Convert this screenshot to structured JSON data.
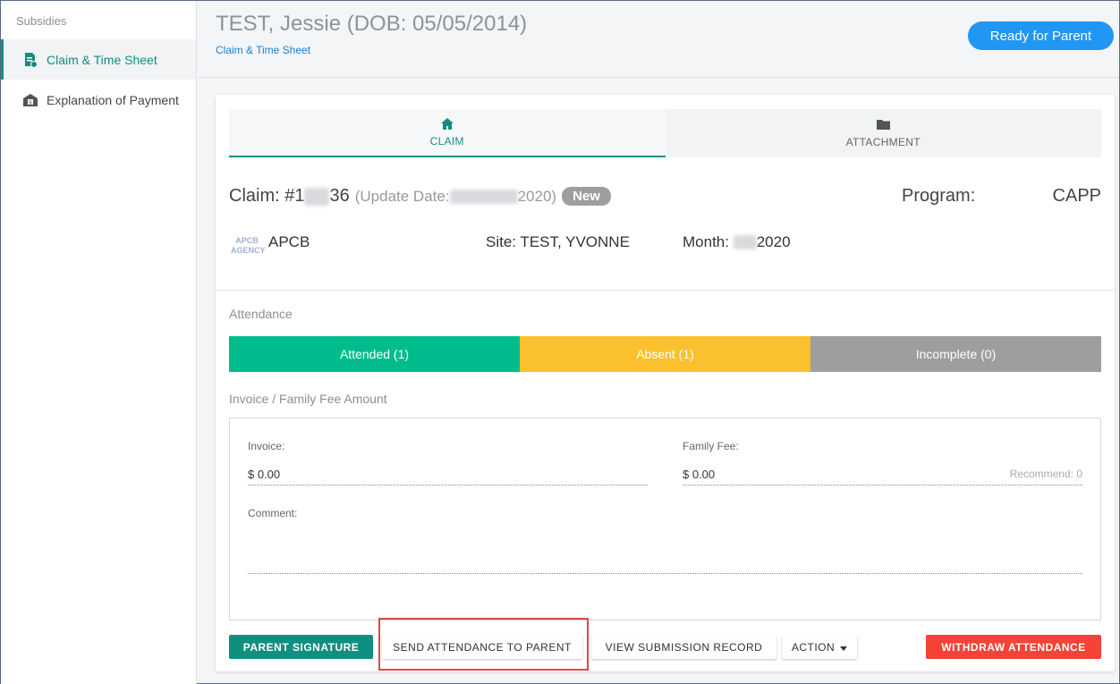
{
  "sidebar": {
    "heading": "Subsidies",
    "items": [
      {
        "label": "Claim & Time Sheet",
        "icon": "document-dollar-icon",
        "active": true
      },
      {
        "label": "Explanation of Payment",
        "icon": "building-dollar-icon",
        "active": false
      }
    ]
  },
  "header": {
    "title": "TEST, Jessie (DOB: 05/05/2014)",
    "breadcrumb": "Claim & Time Sheet",
    "status_button": "Ready for Parent"
  },
  "tabs": [
    {
      "label": "CLAIM",
      "icon": "home-icon",
      "active": true
    },
    {
      "label": "ATTACHMENT",
      "icon": "folder-icon",
      "active": false
    }
  ],
  "claim": {
    "prefix": "Claim: #1",
    "suffix": "36",
    "update_prefix": "(Update Date: ",
    "update_suffix": "2020)",
    "status": "New",
    "program_label": "Program:",
    "program_value": "CAPP",
    "agency_logo_text": "APCB AGENCY",
    "agency": "APCB",
    "site": "Site: TEST, YVONNE",
    "month_prefix": "Month: ",
    "month_suffix": "2020"
  },
  "attendance": {
    "title": "Attendance",
    "segments": [
      {
        "label": "Attended (1)",
        "color": "#00bc8c"
      },
      {
        "label": "Absent (1)",
        "color": "#fbc02d"
      },
      {
        "label": "Incomplete (0)",
        "color": "#9e9e9e"
      }
    ]
  },
  "fees": {
    "title": "Invoice / Family Fee Amount",
    "invoice_label": "Invoice:",
    "invoice_value": "$ 0.00",
    "family_fee_label": "Family Fee:",
    "family_fee_value": "$ 0.00",
    "recommend": "Recommend: 0",
    "comment_label": "Comment:"
  },
  "buttons": {
    "parent_signature": "PARENT SIGNATURE",
    "send_attendance": "SEND ATTENDANCE TO PARENT",
    "view_submission": "VIEW SUBMISSION RECORD",
    "action": "ACTION",
    "withdraw": "WITHDRAW ATTENDANCE"
  },
  "colors": {
    "accent": "#0f8f80",
    "primary": "#2196f3",
    "danger": "#f44336",
    "highlight": "#e0454d"
  }
}
